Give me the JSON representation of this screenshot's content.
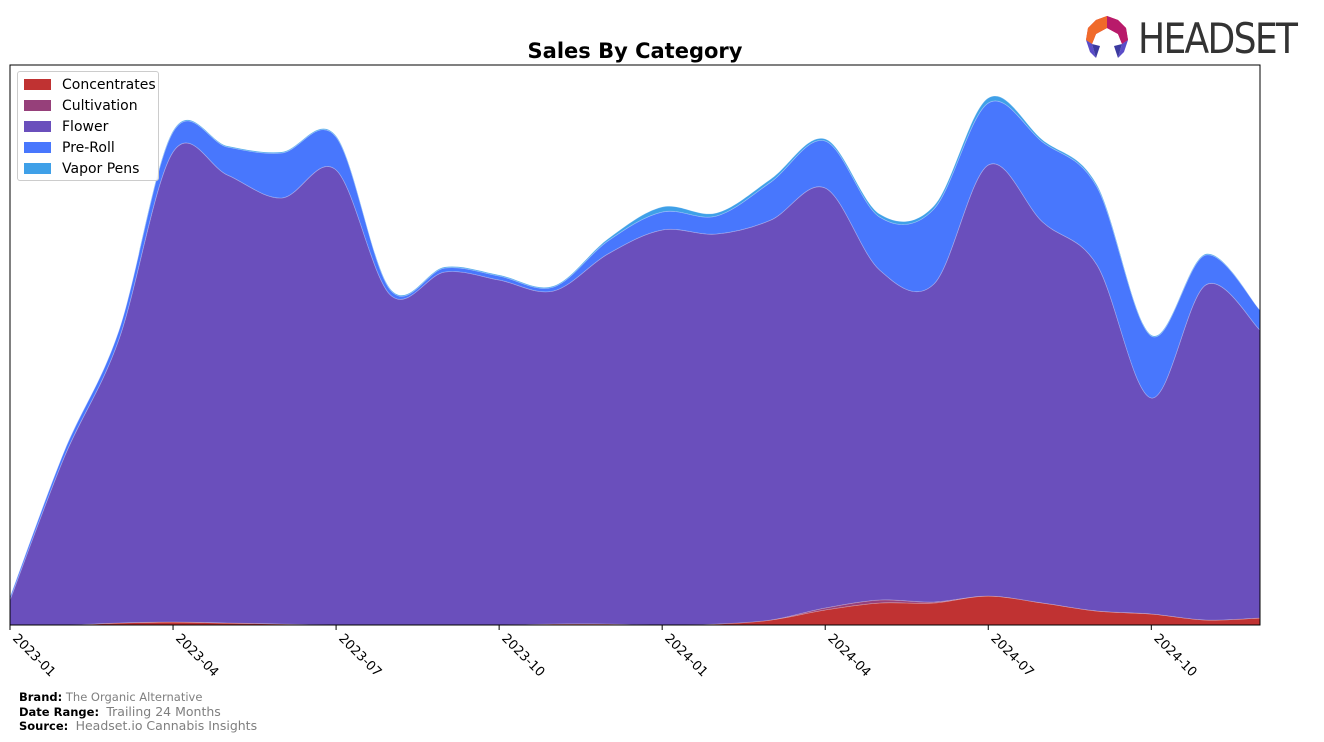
{
  "header": {
    "logo_text": "HEADSET"
  },
  "footer": {
    "brand_label": "Brand:",
    "brand_value": "The Organic Alternative",
    "date_range_label": "Date Range:",
    "date_range_value": "Trailing 24 Months",
    "source_label": "Source:",
    "source_value": "Headset.io Cannabis Insights"
  },
  "chart_data": {
    "type": "area",
    "stacked": true,
    "smoothed": true,
    "title": "Sales By Category",
    "xlabel": "",
    "ylabel": "",
    "y_axis_visible": false,
    "grid": false,
    "legend_position": "top-left",
    "x": [
      "2023-01",
      "2023-02",
      "2023-03",
      "2023-04",
      "2023-05",
      "2023-06",
      "2023-07",
      "2023-08",
      "2023-09",
      "2023-10",
      "2023-11",
      "2023-12",
      "2024-01",
      "2024-02",
      "2024-03",
      "2024-04",
      "2024-05",
      "2024-06",
      "2024-07",
      "2024-08",
      "2024-09",
      "2024-10",
      "2024-11",
      "2024-12"
    ],
    "x_tick_labels": [
      "2023-01",
      "2023-04",
      "2023-07",
      "2023-10",
      "2024-01",
      "2024-04",
      "2024-07",
      "2024-10"
    ],
    "ylim": [
      0,
      560
    ],
    "series": [
      {
        "name": "Concentrates",
        "color": "#c03232",
        "values": [
          0,
          0,
          2,
          3,
          2,
          1,
          0,
          0,
          0,
          0,
          1,
          1,
          0,
          1,
          5,
          15,
          22,
          22,
          29,
          22,
          14,
          11,
          5,
          7
        ]
      },
      {
        "name": "Cultivation",
        "color": "#96407a",
        "values": [
          0,
          0,
          0,
          0,
          0,
          0,
          0,
          0,
          0,
          0,
          0,
          0,
          0,
          0,
          0,
          2,
          3,
          1,
          0,
          0,
          0,
          0,
          0,
          0
        ]
      },
      {
        "name": "Flower",
        "color": "#6a4fbc",
        "values": [
          25,
          168,
          283,
          470,
          448,
          426,
          455,
          330,
          353,
          345,
          333,
          370,
          395,
          390,
          400,
          420,
          330,
          318,
          431,
          381,
          346,
          216,
          335,
          288
        ]
      },
      {
        "name": "Pre-Roll",
        "color": "#4877fd",
        "values": [
          3,
          6,
          9,
          20,
          28,
          45,
          33,
          5,
          4,
          4,
          4,
          13,
          18,
          18,
          38,
          47,
          53,
          75,
          62,
          80,
          78,
          62,
          30,
          20
        ]
      },
      {
        "name": "Vapor Pens",
        "color": "#3fa0e8",
        "values": [
          0,
          0,
          0,
          1,
          1,
          1,
          1,
          1,
          1,
          1,
          1,
          2,
          5,
          3,
          3,
          2,
          3,
          3,
          5,
          2,
          2,
          1,
          1,
          0
        ]
      }
    ]
  }
}
